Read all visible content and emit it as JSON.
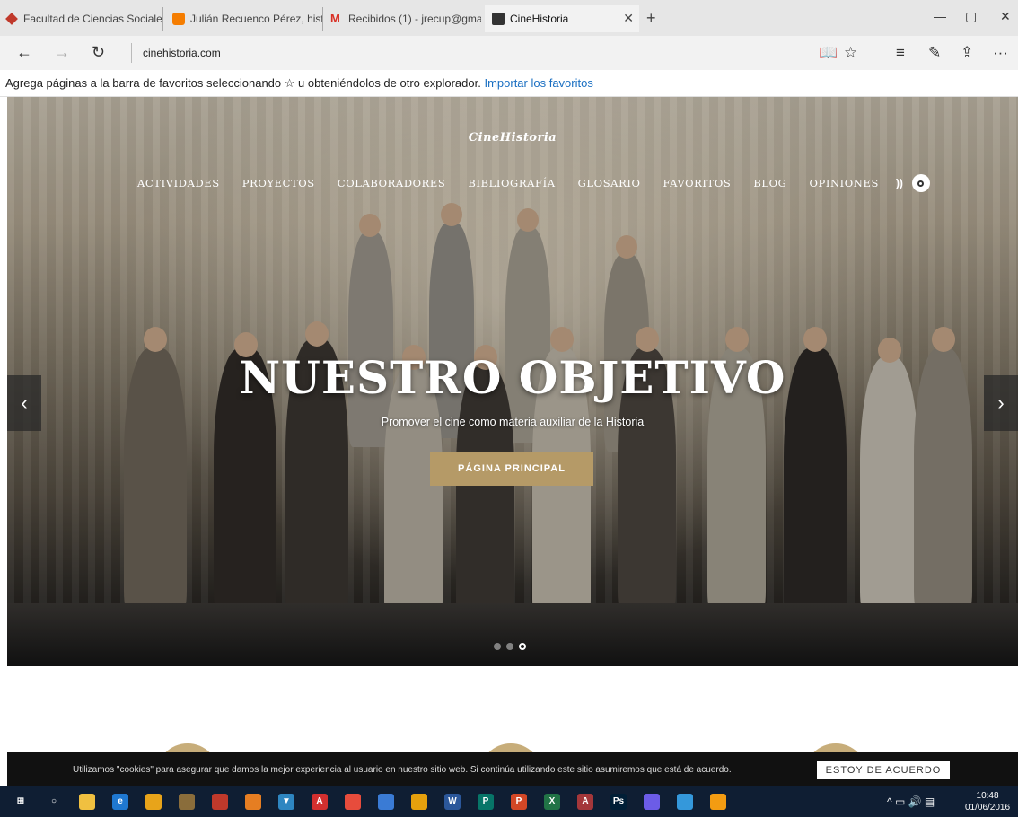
{
  "browser": {
    "tabs": [
      {
        "label": "Facultad de Ciencias Sociale",
        "favicon": "diamond-red",
        "color": "#c0392b"
      },
      {
        "label": "Julián Recuenco Pérez, histc",
        "favicon": "blogger",
        "color": "#f57d00"
      },
      {
        "label": "Recibidos (1) - jrecup@gma",
        "favicon": "gmail",
        "color": "#d93025"
      },
      {
        "label": "CineHistoria",
        "favicon": "cinehistoria",
        "color": "#333333",
        "active": true
      }
    ],
    "new_tab": "+",
    "window_controls": {
      "minimize": "—",
      "restore": "▢",
      "close": "✕"
    },
    "address": "cinehistoria.com",
    "nav": {
      "back": "←",
      "forward": "→",
      "refresh": "↻"
    },
    "tools": {
      "reading_view": "📖",
      "favorite": "☆",
      "hub": "≡",
      "note": "✎",
      "share": "⇪",
      "more": "···"
    }
  },
  "favorites_bar": {
    "text": "Agrega páginas a la barra de favoritos seleccionando ☆ u obteniéndolos de otro explorador.",
    "link": "Importar los favoritos"
  },
  "site": {
    "logo": "CineHistoria",
    "menu": [
      "ACTIVIDADES",
      "PROYECTOS",
      "COLABORADORES",
      "BIBLIOGRAFÍA",
      "GLOSARIO",
      "FAVORITOS",
      "BLOG",
      "OPINIONES"
    ],
    "hero": {
      "title": "NUESTRO OBJETIVO",
      "subtitle": "Promover el cine como materia auxiliar de la Historia",
      "button": "PÁGINA PRINCIPAL",
      "prev": "‹",
      "next": "›",
      "slides_total": 3,
      "slide_active": 3
    },
    "accent": "#b59a67"
  },
  "cookie": {
    "text": "Utilizamos \"cookies\" para asegurar que damos la mejor experiencia al usuario en nuestro sitio web. Si continúa utilizando este sitio asumiremos que está de acuerdo.",
    "button": "ESTOY DE ACUERDO"
  },
  "taskbar": {
    "apps": [
      {
        "icon": "windows-start-icon",
        "glyph": "⊞",
        "color": "transparent"
      },
      {
        "icon": "cortana-search-icon",
        "glyph": "○",
        "color": "transparent"
      },
      {
        "icon": "file-explorer-icon",
        "glyph": "",
        "color": "#f0c040"
      },
      {
        "icon": "edge-icon",
        "glyph": "e",
        "color": "#1f78d1"
      },
      {
        "icon": "chrome-icon",
        "glyph": "",
        "color": "#e8a41a"
      },
      {
        "icon": "app-icon",
        "glyph": "",
        "color": "#8a6d3b"
      },
      {
        "icon": "app-icon",
        "glyph": "",
        "color": "#c0392b"
      },
      {
        "icon": "app-icon",
        "glyph": "",
        "color": "#e67e22"
      },
      {
        "icon": "app-icon",
        "glyph": "▼",
        "color": "#2e86c1"
      },
      {
        "icon": "acrobat-icon",
        "glyph": "A",
        "color": "#d32f2f"
      },
      {
        "icon": "app-icon",
        "glyph": "",
        "color": "#e74c3c"
      },
      {
        "icon": "app-icon",
        "glyph": "",
        "color": "#3a7bd5"
      },
      {
        "icon": "app-icon",
        "glyph": "",
        "color": "#e5a00d"
      },
      {
        "icon": "word-icon",
        "glyph": "W",
        "color": "#2b579a"
      },
      {
        "icon": "publisher-icon",
        "glyph": "P",
        "color": "#077568"
      },
      {
        "icon": "powerpoint-icon",
        "glyph": "P",
        "color": "#d24726"
      },
      {
        "icon": "excel-icon",
        "glyph": "X",
        "color": "#217346"
      },
      {
        "icon": "access-icon",
        "glyph": "A",
        "color": "#a4373a"
      },
      {
        "icon": "photoshop-icon",
        "glyph": "Ps",
        "color": "#001e36"
      },
      {
        "icon": "app-icon",
        "glyph": "",
        "color": "#6c5ce7"
      },
      {
        "icon": "app-icon",
        "glyph": "",
        "color": "#3498db"
      },
      {
        "icon": "app-icon",
        "glyph": "",
        "color": "#f39c12"
      }
    ],
    "tray": "^  ▭ 🔊 ▤",
    "time": "10:48",
    "date": "01/06/2016"
  }
}
